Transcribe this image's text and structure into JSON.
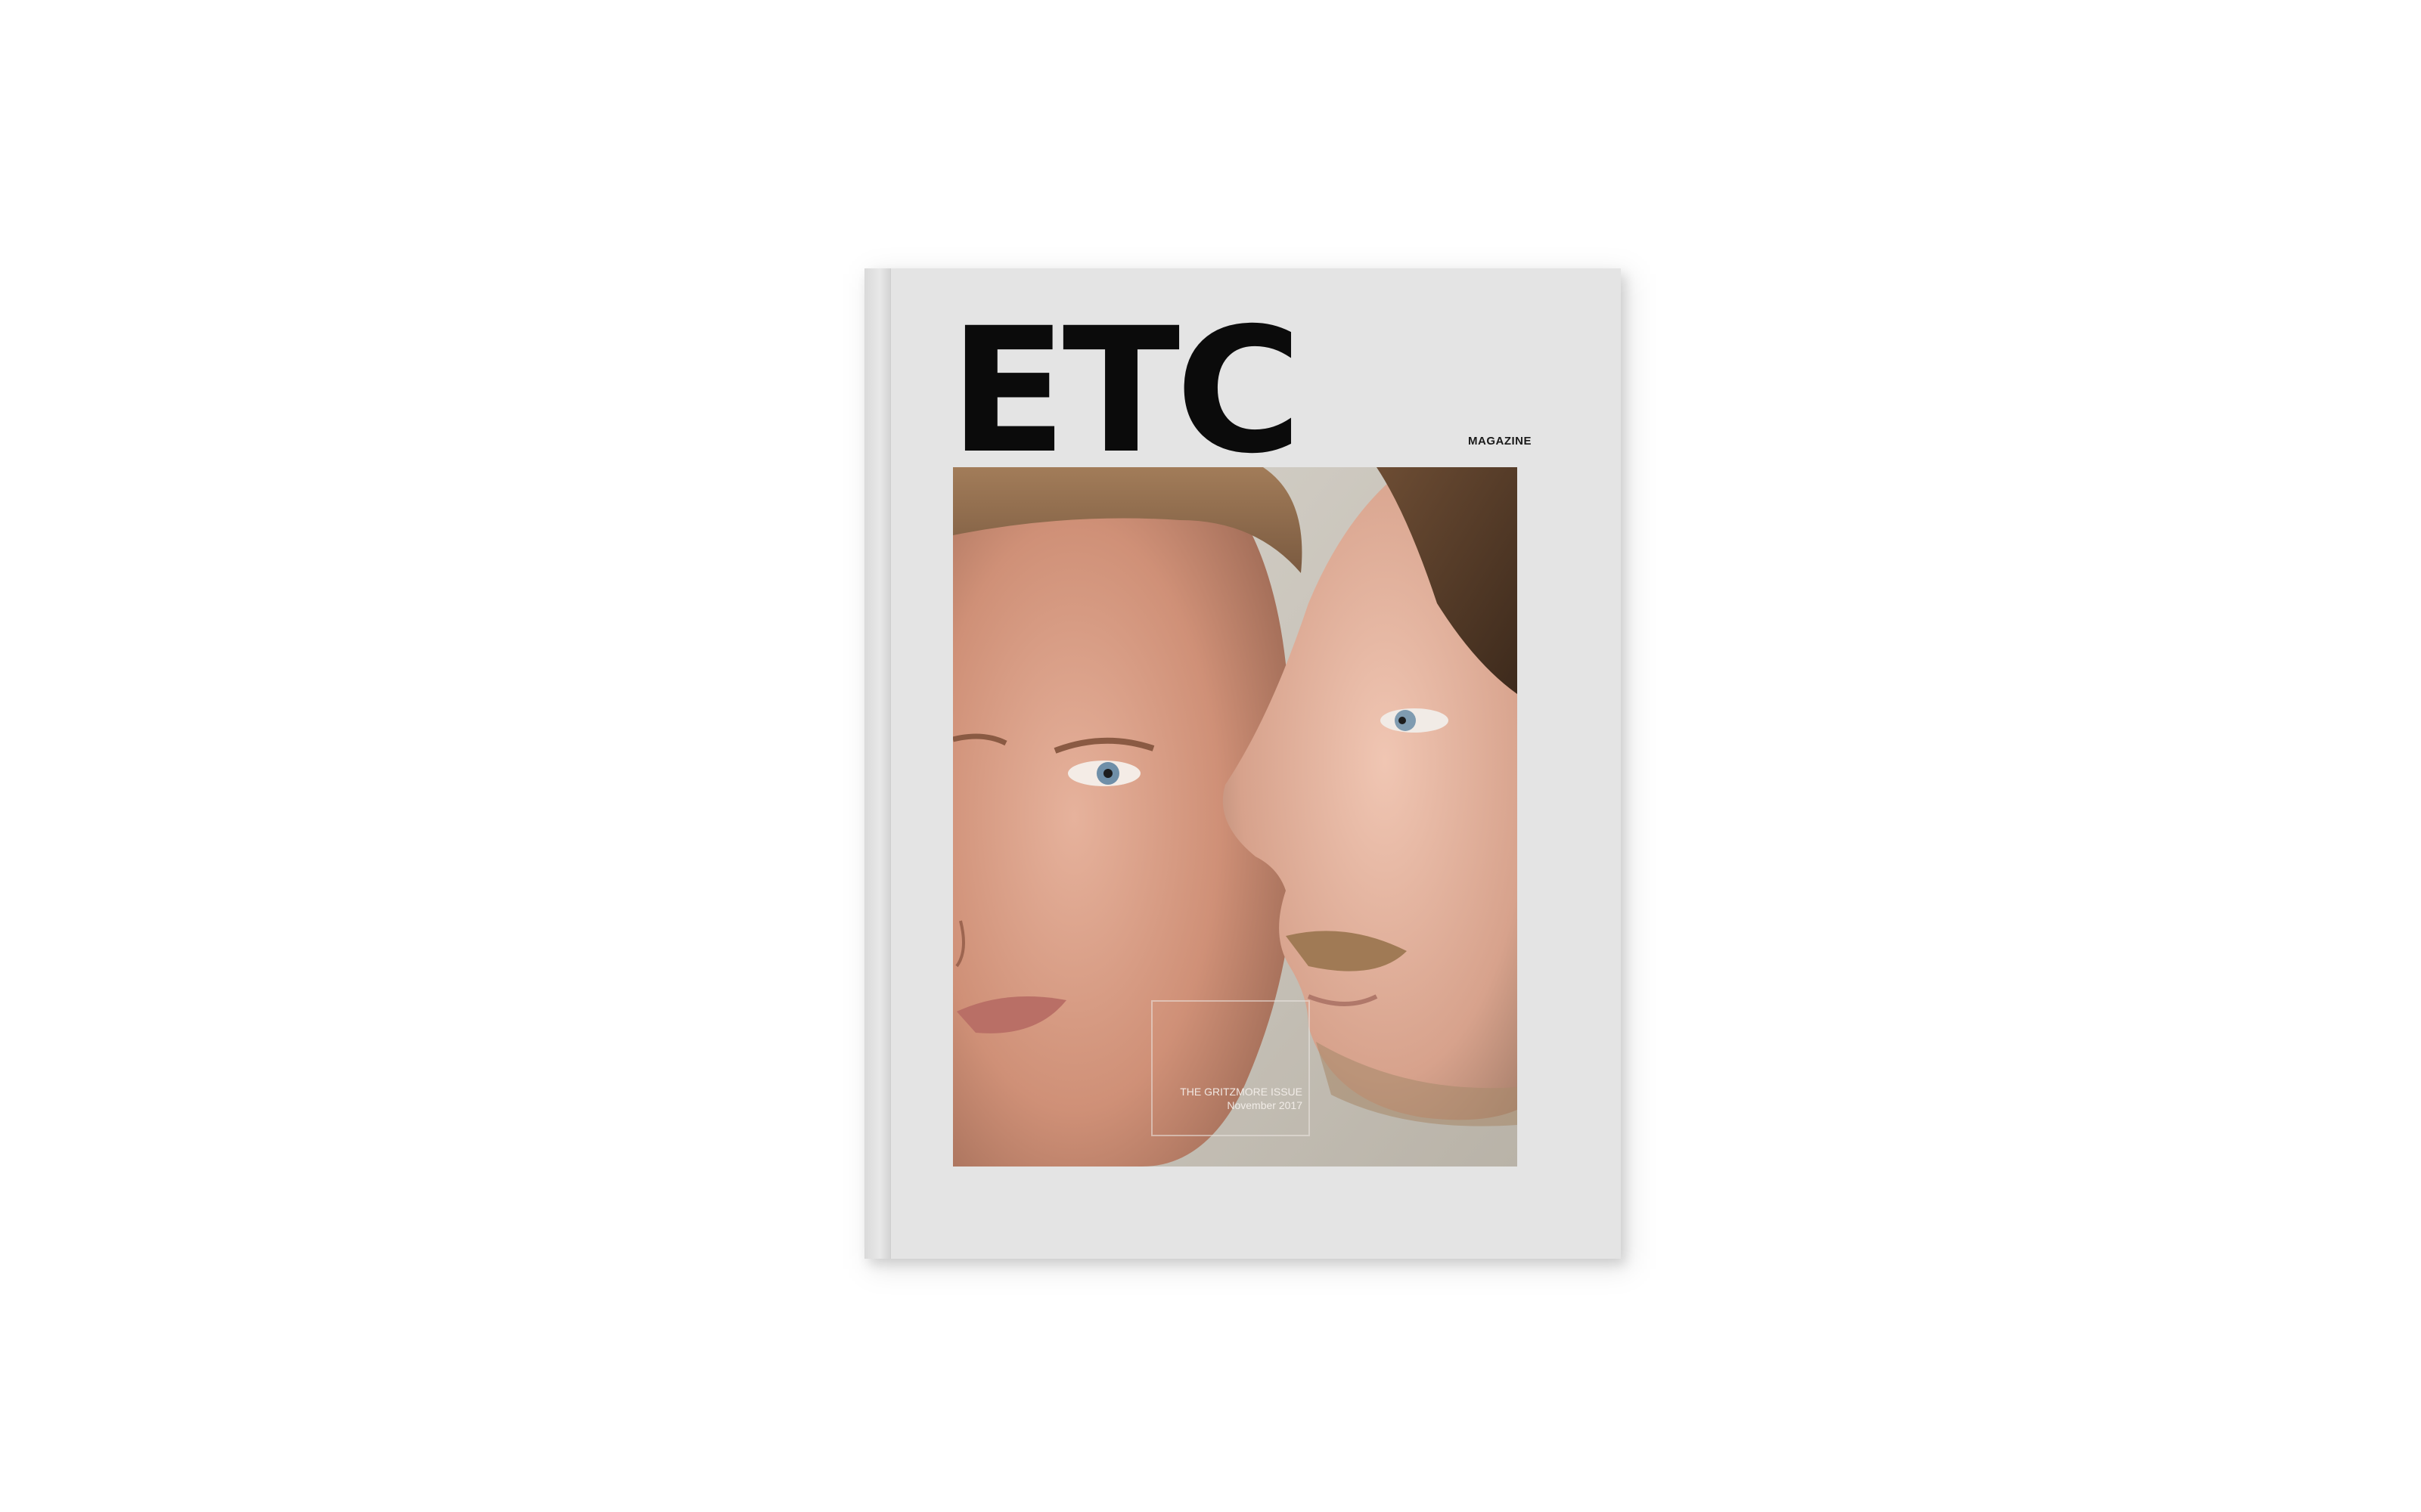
{
  "magazine": {
    "logo": "ETC",
    "tagline": "MAGAZINE",
    "issue_title": "THE GRITZMORE ISSUE",
    "issue_date": "November 2017"
  },
  "colors": {
    "background": "#ffffff",
    "cover": "#e4e4e4",
    "logo": "#0b0b0b"
  }
}
